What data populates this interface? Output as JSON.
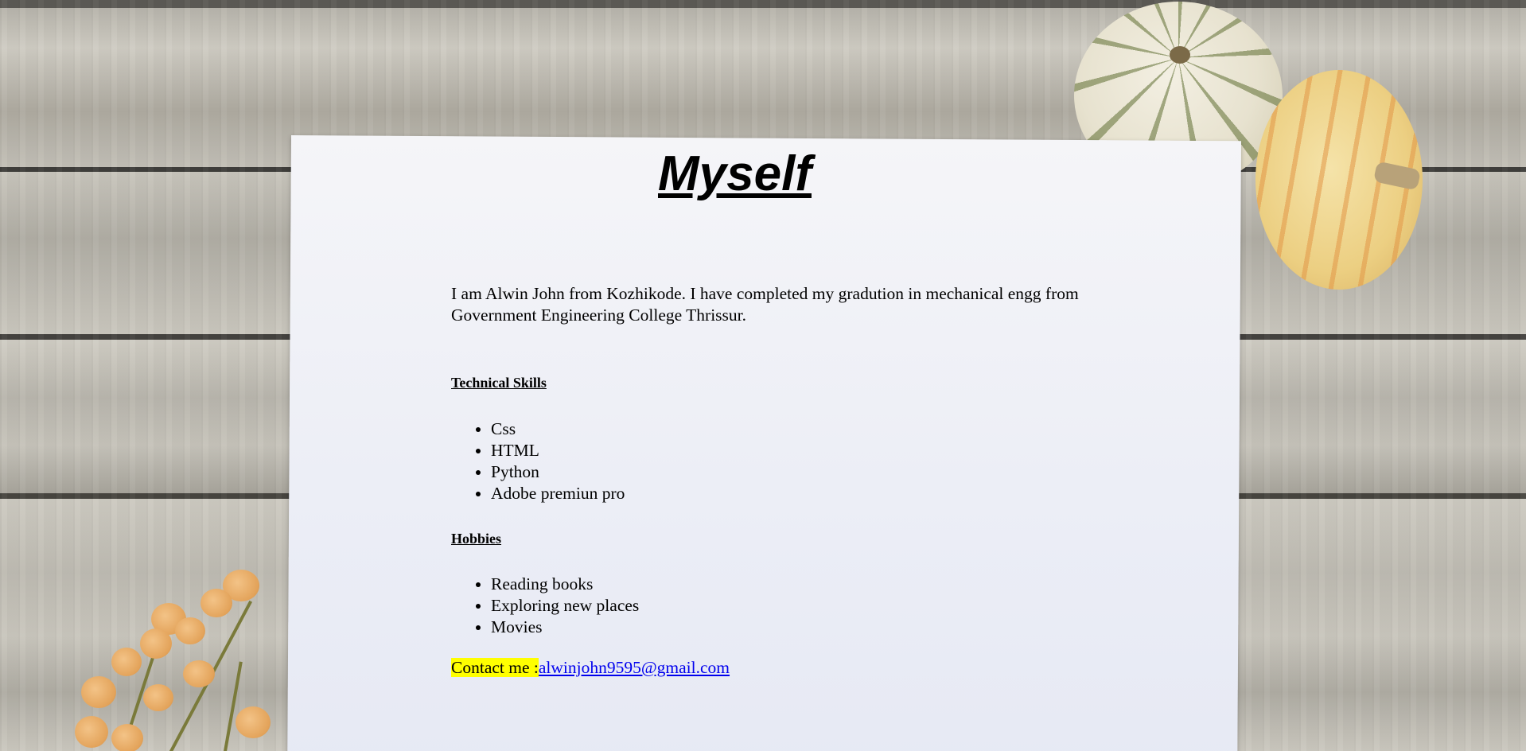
{
  "page": {
    "title": "Myself",
    "intro": "I am Alwin John from Kozhikode. I have completed my gradution in mechanical engg from Government Engineering College Thrissur."
  },
  "skills": {
    "heading": "Technical Skills",
    "items": [
      "Css",
      "HTML",
      "Python",
      "Adobe premiun pro"
    ]
  },
  "hobbies": {
    "heading": "Hobbies",
    "items": [
      "Reading books",
      "Exploring new places",
      "Movies"
    ]
  },
  "contact": {
    "label": "Contact me :",
    "email": "alwinjohn9595@gmail.com"
  },
  "colors": {
    "highlight": "#ffff00",
    "link": "#0000ee"
  }
}
